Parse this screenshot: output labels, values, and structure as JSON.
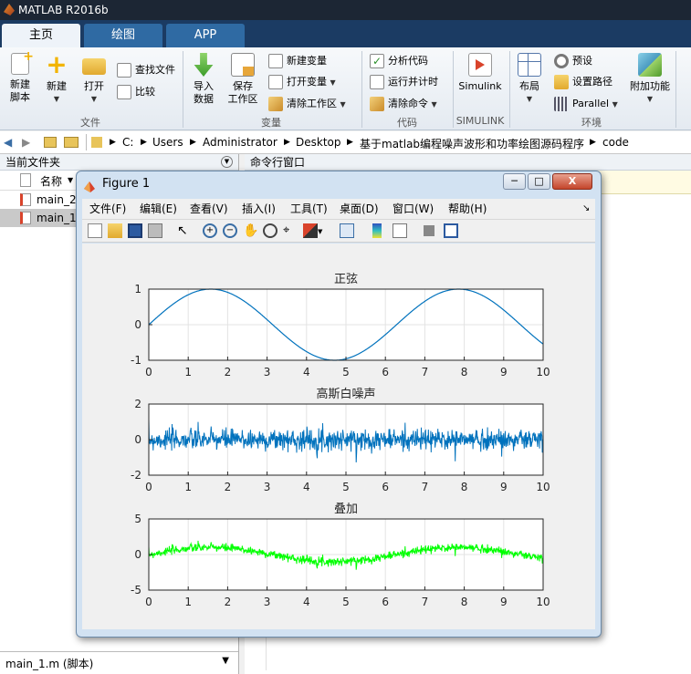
{
  "window": {
    "title": "MATLAB R2016b"
  },
  "tabs": [
    {
      "label": "主页"
    },
    {
      "label": "绘图"
    },
    {
      "label": "APP"
    }
  ],
  "ribbon": {
    "new_script": "新建\n脚本",
    "new": "新建",
    "open": "打开",
    "find_files": "查找文件",
    "compare": "比较",
    "import_data": "导入\n数据",
    "save_workspace": "保存\n工作区",
    "new_variable": "新建变量",
    "open_variable": "打开变量",
    "clear_workspace": "清除工作区",
    "analyze_code": "分析代码",
    "run_and_time": "运行并计时",
    "clear_commands": "清除命令",
    "simulink": "Simulink",
    "layout": "布局",
    "preferences": "预设",
    "set_path": "设置路径",
    "parallel": "Parallel",
    "addons": "附加功能",
    "groups": {
      "file": "文件",
      "variable": "变量",
      "code": "代码",
      "simulink": "SIMULINK",
      "environment": "环境"
    }
  },
  "path": {
    "crumbs": [
      "C:",
      "Users",
      "Administrator",
      "Desktop",
      "基于matlab编程噪声波形和功率绘图源码程序",
      "code"
    ]
  },
  "current_folder": {
    "title": "当前文件夹",
    "column": "名称",
    "files": [
      "main_2",
      "main_1."
    ],
    "details": "main_1.m  (脚本)"
  },
  "command_window": {
    "title": "命令行窗口"
  },
  "figure": {
    "title": "Figure 1",
    "menu": [
      "文件(F)",
      "编辑(E)",
      "查看(V)",
      "插入(I)",
      "工具(T)",
      "桌面(D)",
      "窗口(W)",
      "帮助(H)"
    ],
    "win_close": "X"
  },
  "colors": {
    "sine": "#0072bd",
    "noise": "#0072bd",
    "sum": "#00ff00"
  },
  "chart_data": [
    {
      "type": "line",
      "title": "正弦",
      "function": "sin(x)",
      "xlim": [
        0,
        10
      ],
      "ylim": [
        -1,
        1
      ],
      "xticks": [
        "0",
        "1",
        "2",
        "3",
        "4",
        "5",
        "6",
        "7",
        "8",
        "9",
        "10"
      ],
      "yticks": [
        "1",
        "0",
        "-1"
      ],
      "grid": true
    },
    {
      "type": "line",
      "title": "高斯白噪声",
      "function": "gaussian white noise, sigma≈0.3",
      "xlim": [
        0,
        10
      ],
      "ylim": [
        -2,
        2
      ],
      "xticks": [
        "0",
        "1",
        "2",
        "3",
        "4",
        "5",
        "6",
        "7",
        "8",
        "9",
        "10"
      ],
      "yticks": [
        "2",
        "0",
        "-2"
      ],
      "grid": true
    },
    {
      "type": "line",
      "title": "叠加",
      "function": "sin(x) + noise",
      "xlim": [
        0,
        10
      ],
      "ylim": [
        -5,
        5
      ],
      "xticks": [
        "0",
        "1",
        "2",
        "3",
        "4",
        "5",
        "6",
        "7",
        "8",
        "9",
        "10"
      ],
      "yticks": [
        "5",
        "0",
        "-5"
      ],
      "grid": true
    }
  ]
}
